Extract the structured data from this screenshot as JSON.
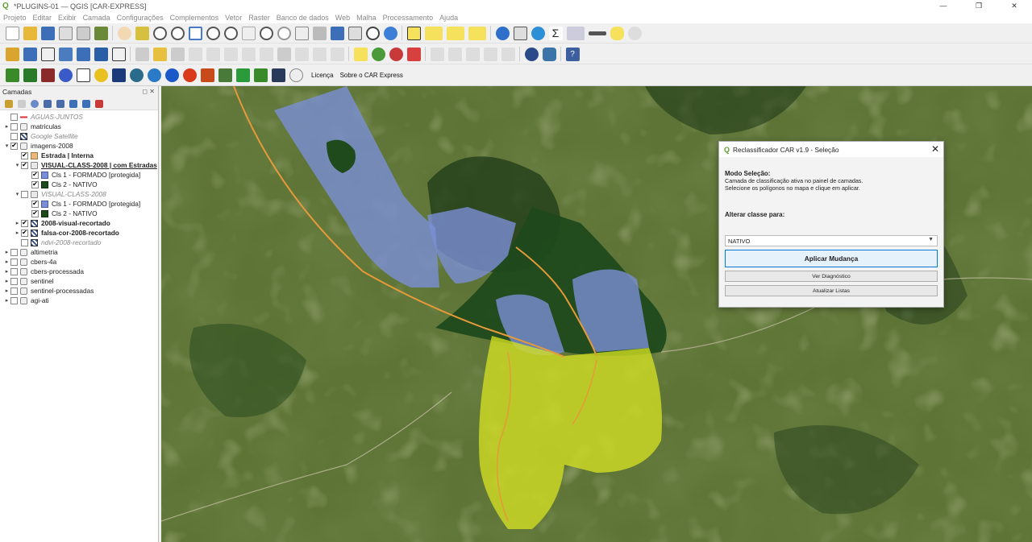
{
  "window": {
    "title": "*PLUGINS-01 — QGIS [CAR-EXPRESS]",
    "minimize": "—",
    "restore": "❐",
    "close": "✕"
  },
  "menu": [
    "Projeto",
    "Editar",
    "Exibir",
    "Camada",
    "Configurações",
    "Complementos",
    "Vetor",
    "Raster",
    "Banco de dados",
    "Web",
    "Malha",
    "Processamento",
    "Ajuda"
  ],
  "toolbar3": {
    "license_label": "Licença",
    "about_label": "Sobre o CAR Express"
  },
  "panel": {
    "title": "Camadas",
    "header_buttons": "◻ ✕",
    "layers": [
      {
        "name": "AGUAS-JUNTOS",
        "indent": 0,
        "arrow": "",
        "checked": false,
        "style": "italic",
        "icon": "line-red"
      },
      {
        "name": "matriculas",
        "indent": 0,
        "arrow": "▸",
        "checked": false,
        "style": "",
        "icon": "group"
      },
      {
        "name": "Google Satellite",
        "indent": 0,
        "arrow": "",
        "checked": false,
        "style": "italic",
        "icon": "raster"
      },
      {
        "name": "imagens-2008",
        "indent": 0,
        "arrow": "▾",
        "checked": true,
        "style": "",
        "icon": "group"
      },
      {
        "name": "Estrada | Interna",
        "indent": 1,
        "arrow": "",
        "checked": true,
        "style": "bold",
        "icon": "fill-tan"
      },
      {
        "name": "VISUAL-CLASS-2008 | com Estradas",
        "indent": 1,
        "arrow": "▾",
        "checked": true,
        "style": "bold underline",
        "icon": "polygon"
      },
      {
        "name": "Cls 1 - FORMADO [protegida]",
        "indent": 2,
        "arrow": "",
        "checked": true,
        "style": "",
        "icon": "fill-blue"
      },
      {
        "name": "Cls 2 - NATIVO",
        "indent": 2,
        "arrow": "",
        "checked": true,
        "style": "",
        "icon": "fill-green"
      },
      {
        "name": "VISUAL-CLASS-2008",
        "indent": 1,
        "arrow": "▾",
        "checked": false,
        "style": "italic",
        "icon": "polygon"
      },
      {
        "name": "Cls 1 - FORMADO [protegida]",
        "indent": 2,
        "arrow": "",
        "checked": true,
        "style": "",
        "icon": "fill-blue"
      },
      {
        "name": "Cls 2 - NATIVO",
        "indent": 2,
        "arrow": "",
        "checked": true,
        "style": "",
        "icon": "fill-green"
      },
      {
        "name": "2008-visual-recortado",
        "indent": 1,
        "arrow": "▸",
        "checked": true,
        "style": "bold",
        "icon": "raster"
      },
      {
        "name": "falsa-cor-2008-recortado",
        "indent": 1,
        "arrow": "▸",
        "checked": true,
        "style": "bold",
        "icon": "raster"
      },
      {
        "name": "ndvi-2008-recortado",
        "indent": 1,
        "arrow": "",
        "checked": false,
        "style": "italic",
        "icon": "raster"
      },
      {
        "name": "altimetria",
        "indent": 0,
        "arrow": "▸",
        "checked": false,
        "style": "",
        "icon": "group"
      },
      {
        "name": "cbers-4a",
        "indent": 0,
        "arrow": "▸",
        "checked": false,
        "style": "",
        "icon": "group"
      },
      {
        "name": "cbers-processada",
        "indent": 0,
        "arrow": "▸",
        "checked": false,
        "style": "",
        "icon": "group"
      },
      {
        "name": "sentinel",
        "indent": 0,
        "arrow": "▸",
        "checked": false,
        "style": "",
        "icon": "group"
      },
      {
        "name": "sentinel-processadas",
        "indent": 0,
        "arrow": "▸",
        "checked": false,
        "style": "",
        "icon": "group"
      },
      {
        "name": "agi-ati",
        "indent": 0,
        "arrow": "▸",
        "checked": false,
        "style": "",
        "icon": "group"
      }
    ]
  },
  "dialog": {
    "title": "Reclassificador CAR v1.9 - Seleção",
    "close": "✕",
    "mode_heading": "Modo Seleção:",
    "mode_line1": "Camada de classificação ativa no painel de camadas.",
    "mode_line2": "Selecione os polígonos no mapa e clique em aplicar.",
    "change_label": "Alterar classe para:",
    "class_value": "NATIVO",
    "apply_button": "Aplicar Mudança",
    "diagnostic_button": "Ver Diagnóstico",
    "refresh_button": "Atualizar Listas"
  },
  "colors": {
    "formado": "#7b8fd6",
    "nativo": "#1f4a1c",
    "selection": "#d4e022",
    "roads": "#e59a3a",
    "accent": "#0078d7"
  }
}
